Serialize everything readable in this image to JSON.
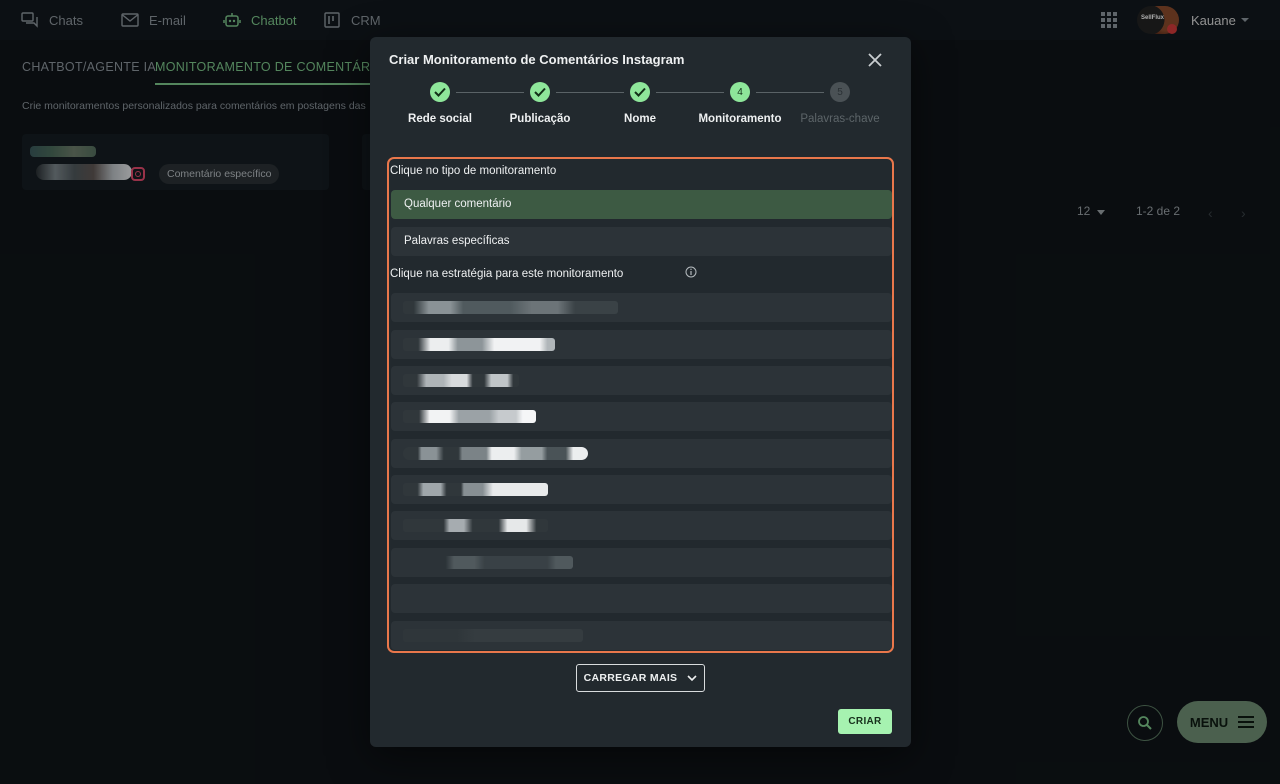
{
  "topnav": {
    "items": [
      {
        "label": "Chats",
        "icon": "chats-icon"
      },
      {
        "label": "E-mail",
        "icon": "mail-icon"
      },
      {
        "label": "Chatbot",
        "icon": "robot-icon",
        "active": true
      },
      {
        "label": "CRM",
        "icon": "kanban-icon"
      }
    ],
    "username": "Kauane",
    "avatar_text": "SellFlux"
  },
  "page": {
    "tabs": [
      "CHATBOT/AGENTE IA",
      "MONITORAMENTO DE COMENTÁRIOS I"
    ],
    "description": "Crie monitoramentos personalizados para comentários em postagens das",
    "card_chip": "Comentário específico",
    "pager": {
      "page_size": "12",
      "range": "1-2 de 2"
    },
    "fab_menu_label": "MENU"
  },
  "modal": {
    "title": "Criar Monitoramento de Comentários Instagram",
    "steps": [
      {
        "label": "Rede social",
        "state": "done",
        "number": ""
      },
      {
        "label": "Publicação",
        "state": "done",
        "number": ""
      },
      {
        "label": "Nome",
        "state": "done",
        "number": ""
      },
      {
        "label": "Monitoramento",
        "state": "current",
        "number": "4"
      },
      {
        "label": "Palavras-chave",
        "state": "todo",
        "number": "5"
      }
    ],
    "type_prompt": "Clique no tipo de monitoramento",
    "type_options": [
      {
        "label": "Qualquer comentário",
        "selected": true
      },
      {
        "label": "Palavras específicas",
        "selected": false
      }
    ],
    "strategy_prompt": "Clique na estratégia para este monitoramento",
    "strategies_redacted_count": 10,
    "load_more_label": "CARREGAR MAIS",
    "create_label": "CRIAR"
  },
  "colors": {
    "accent": "#7cc68a",
    "step_done": "#8ee69a",
    "highlight_border": "#e9774b",
    "selected_option": "#3d5a43",
    "create_button": "#a6f2b0"
  }
}
